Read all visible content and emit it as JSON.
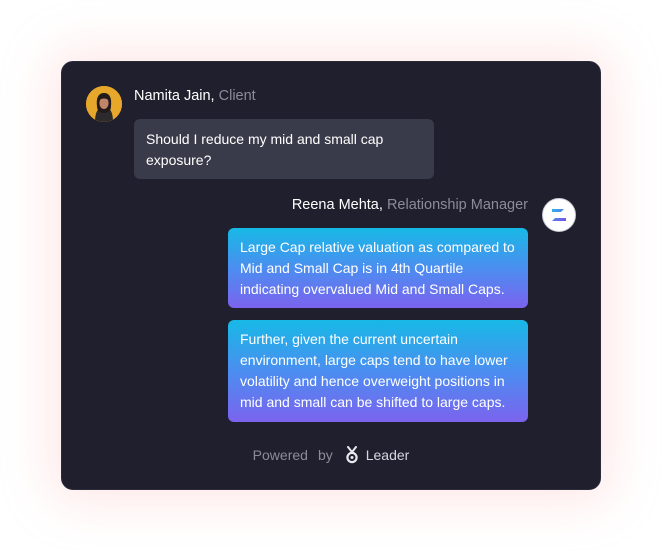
{
  "client": {
    "name": "Namita Jain,",
    "role": "Client",
    "message": "Should I reduce my mid and small cap exposure?"
  },
  "manager": {
    "name": "Reena Mehta,",
    "role": "Relationship Manager",
    "messages": [
      "Large Cap relative valuation as compared to Mid and Small Cap is in 4th Quartile indicating overvalued Mid and Small Caps.",
      "Further, given the current uncertain environment, large caps tend to have lower volatility and hence overweight positions in mid and small can be shifted to large caps."
    ]
  },
  "footer": {
    "powered": "Powered",
    "by": "by",
    "brand": "Leader"
  },
  "icons": {
    "client_avatar": "client-avatar",
    "manager_avatar": "manager-logo-avatar",
    "brand": "leader-logo-icon"
  },
  "colors": {
    "card_background": "#1f1f2e",
    "client_bubble": "#3a3b4a",
    "manager_bubble_gradient_start": "#17b9e6",
    "manager_bubble_gradient_end": "#7b63ee",
    "client_avatar_bg": "#e6a72a",
    "muted_text": "#8b8b99"
  }
}
